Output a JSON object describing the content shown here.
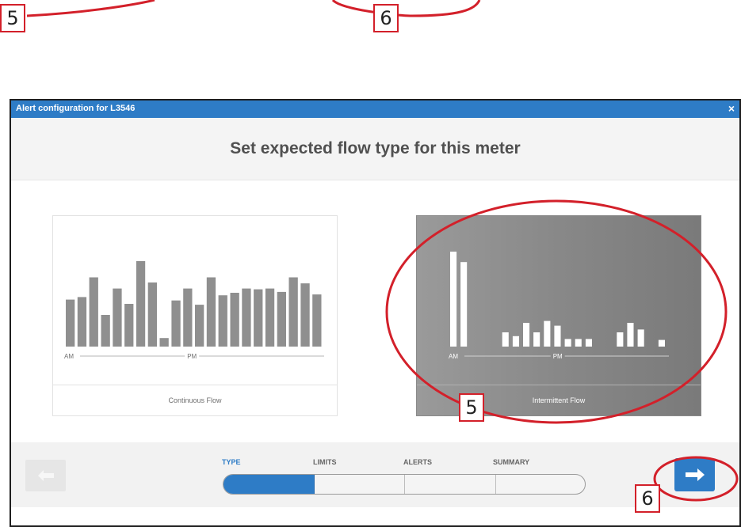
{
  "callouts": {
    "left": "5",
    "mid": "6",
    "card": "5",
    "next": "6"
  },
  "dialog": {
    "title": "Alert configuration for L3546",
    "close": "×",
    "heading": "Set expected flow type for this meter"
  },
  "cards": [
    {
      "label": "Continuous Flow",
      "selected": false,
      "am": "AM",
      "pm": "PM",
      "bars": [
        0.55,
        0.58,
        0.81,
        0.37,
        0.68,
        0.5,
        1.0,
        0.75,
        0.1,
        0.54,
        0.68,
        0.49,
        0.81,
        0.6,
        0.63,
        0.68,
        0.67,
        0.68,
        0.64,
        0.81,
        0.74,
        0.61
      ]
    },
    {
      "label": "Intermittent Flow",
      "selected": true,
      "am": "AM",
      "pm": "PM",
      "bars": [
        1.0,
        0.89,
        0,
        0,
        0,
        0.15,
        0.11,
        0.25,
        0.15,
        0.27,
        0.22,
        0.08,
        0.08,
        0.08,
        0,
        0,
        0.15,
        0.25,
        0.18,
        0,
        0.07
      ]
    }
  ],
  "steps": [
    {
      "label": "TYPE",
      "active": true
    },
    {
      "label": "LIMITS",
      "active": false
    },
    {
      "label": "ALERTS",
      "active": false
    },
    {
      "label": "SUMMARY",
      "active": false
    }
  ],
  "progress": 0.25,
  "colors": {
    "accent": "#2e7cc6",
    "annotation": "#d3202a"
  },
  "icons": {
    "prev": "arrow-left-icon",
    "next": "arrow-right-icon"
  }
}
